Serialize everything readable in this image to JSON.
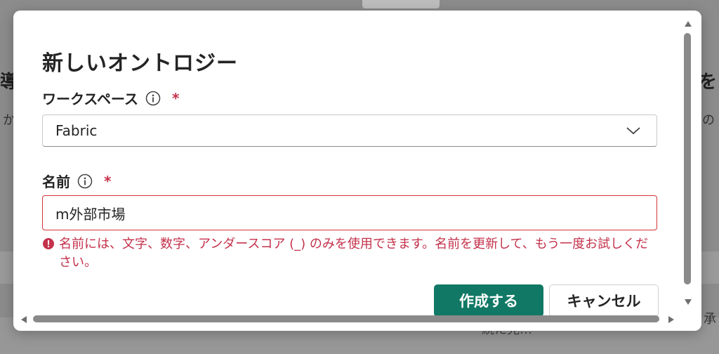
{
  "background": {
    "left_heading": "導前",
    "left_sub": "か",
    "right_heading": "を",
    "right_sub": "の",
    "bottom_right": "承",
    "bottom_center": "続た見…"
  },
  "dialog": {
    "title": "新しいオントロジー",
    "workspace": {
      "label": "ワークスペース",
      "required_mark": "*",
      "value": "Fabric"
    },
    "name": {
      "label": "名前",
      "required_mark": "*",
      "value": "m外部市場",
      "error": "名前には、文字、数字、アンダースコア (_) のみを使用できます。名前を更新して、もう一度お試しください。"
    },
    "buttons": {
      "create": "作成する",
      "cancel": "キャンセル"
    }
  },
  "colors": {
    "primary": "#117865",
    "error": "#c4314b",
    "overlay": "#8c8c8c"
  },
  "icons": [
    "info-icon",
    "chevron-down-icon",
    "error-icon",
    "scroll-up-icon",
    "scroll-down-icon",
    "scroll-left-icon",
    "scroll-right-icon"
  ]
}
